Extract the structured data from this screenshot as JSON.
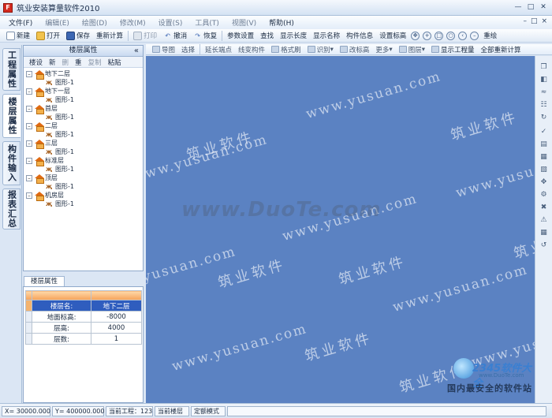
{
  "window": {
    "title": "筑业安装算量软件2010",
    "icon_label": "F"
  },
  "menu": {
    "items": [
      {
        "label": "文件(F)",
        "enabled": true
      },
      {
        "label": "编辑(E)",
        "enabled": false
      },
      {
        "label": "绘图(D)",
        "enabled": false
      },
      {
        "label": "修改(M)",
        "enabled": false
      },
      {
        "label": "设置(S)",
        "enabled": false
      },
      {
        "label": "工具(T)",
        "enabled": false
      },
      {
        "label": "视图(V)",
        "enabled": false
      },
      {
        "label": "帮助(H)",
        "enabled": true
      }
    ]
  },
  "toolbar": {
    "new": "新建",
    "open": "打开",
    "save": "保存",
    "recalc": "重新计算",
    "print": "打印",
    "undo": "撤消",
    "redo": "恢复",
    "param": "参数设置",
    "find": "查找",
    "show_len": "显示长度",
    "show_name": "显示名称",
    "comp_info": "构件信息",
    "set_elev": "设置标高",
    "redraw": "重绘"
  },
  "left_tabs": [
    "工程属性",
    "楼层属性",
    "构件输入",
    "报表汇总"
  ],
  "floor_panel": {
    "title": "楼层属性",
    "tools": [
      {
        "label": "楼设",
        "enabled": true
      },
      {
        "label": "新",
        "enabled": true
      },
      {
        "label": "删",
        "enabled": false
      },
      {
        "label": "重",
        "enabled": true
      },
      {
        "label": "复制",
        "enabled": false
      },
      {
        "label": "粘贴",
        "enabled": true
      }
    ],
    "floors": [
      {
        "name": "地下二层",
        "shape": "图形-1"
      },
      {
        "name": "地下一层",
        "shape": "图形-1"
      },
      {
        "name": "首层",
        "shape": "图形-1"
      },
      {
        "name": "二层",
        "shape": "图形-1"
      },
      {
        "name": "三层",
        "shape": "图形-1"
      },
      {
        "name": "标准层",
        "shape": "图形-1"
      },
      {
        "name": "顶层",
        "shape": "图形-1"
      },
      {
        "name": "机房层",
        "shape": "图形-1"
      }
    ]
  },
  "floor_props": {
    "tab": "楼层属性",
    "rows": [
      {
        "key": "楼层名:",
        "value": "地下二层"
      },
      {
        "key": "地面标高:",
        "value": "-8000"
      },
      {
        "key": "层高:",
        "value": "4000"
      },
      {
        "key": "层数:",
        "value": "1"
      }
    ]
  },
  "draw_toolbar": {
    "items": [
      {
        "label": "导图",
        "enabled": false
      },
      {
        "label": "选择",
        "enabled": false
      },
      {
        "label": "延长端点",
        "enabled": false
      },
      {
        "label": "线变构件",
        "enabled": false
      },
      {
        "label": "格式刷",
        "enabled": false
      },
      {
        "label": "识别",
        "enabled": false
      },
      {
        "label": "改标高",
        "enabled": false
      },
      {
        "label": "更多",
        "enabled": false
      },
      {
        "label": "图层",
        "enabled": false
      },
      {
        "label": "显示工程量",
        "enabled": true
      },
      {
        "label": "全部重新计算",
        "enabled": true
      }
    ]
  },
  "watermarks": {
    "url": "www.yusuan.com",
    "cn": "筑业软件",
    "duote": "www.DuoTe.com",
    "logo_num": "2345软件大全",
    "logo_sub": "www.DuoTe.com",
    "logo_tag": "国内最安全的软件站"
  },
  "statusbar": {
    "x": "X= 30000.000",
    "y": "Y= 400000.000",
    "project": "当前工程：123",
    "floor": "当前楼层",
    "mode": "定额模式"
  },
  "colors": {
    "canvas": "#5b82c2",
    "selection": "#2f5dbe",
    "header_orange": "#f5a25a"
  }
}
